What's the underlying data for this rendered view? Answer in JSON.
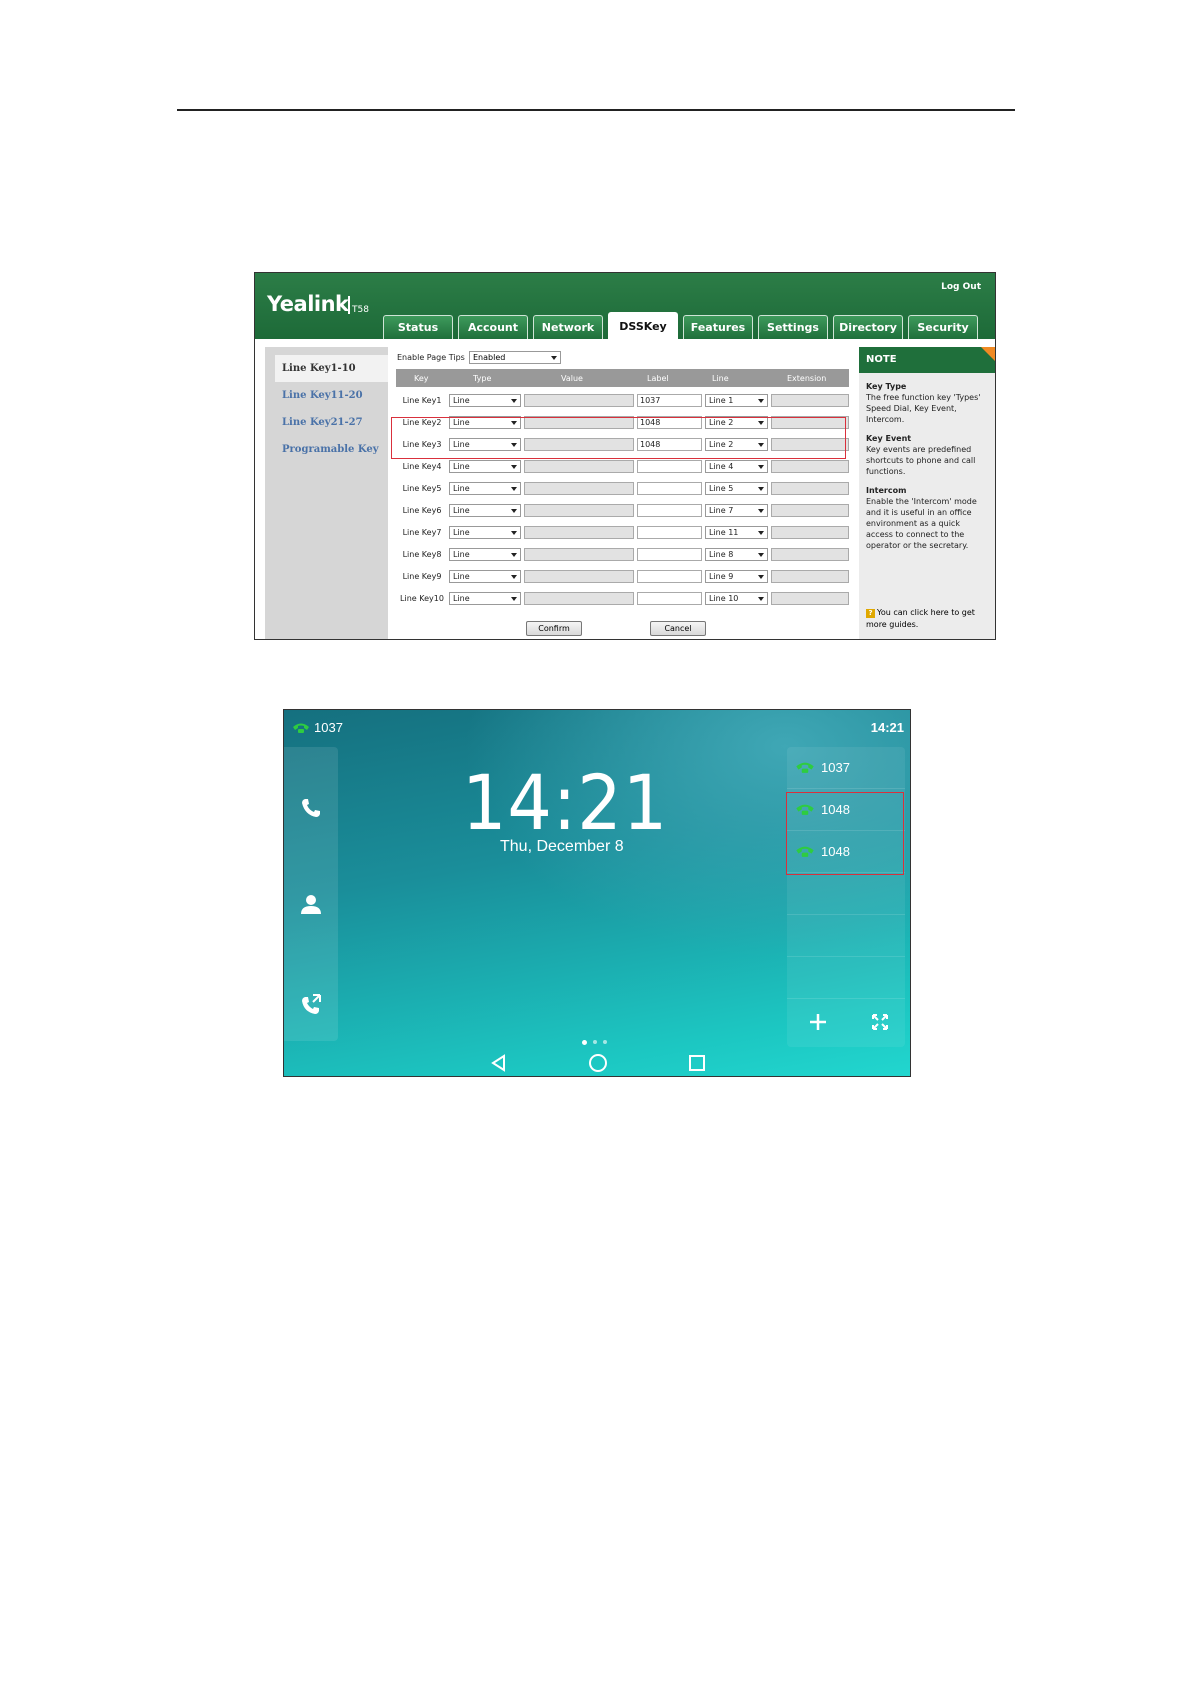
{
  "web": {
    "logo": "Yealink",
    "model": "T58",
    "logout": "Log Out",
    "tabs": [
      "Status",
      "Account",
      "Network",
      "DSSKey",
      "Features",
      "Settings",
      "Directory",
      "Security"
    ],
    "active_tab": "DSSKey",
    "nav": [
      "Line Key1-10",
      "Line Key11-20",
      "Line Key21-27",
      "Programable Key"
    ],
    "enable_page_tips_label": "Enable Page Tips",
    "enable_page_tips_value": "Enabled",
    "columns": [
      "Key",
      "Type",
      "Value",
      "Label",
      "Line",
      "Extension"
    ],
    "rows": [
      {
        "key": "Line Key1",
        "type": "Line",
        "value": "",
        "label": "1037",
        "line": "Line 1"
      },
      {
        "key": "Line Key2",
        "type": "Line",
        "value": "",
        "label": "1048",
        "line": "Line 2"
      },
      {
        "key": "Line Key3",
        "type": "Line",
        "value": "",
        "label": "1048",
        "line": "Line 2"
      },
      {
        "key": "Line Key4",
        "type": "Line",
        "value": "",
        "label": "",
        "line": "Line 4"
      },
      {
        "key": "Line Key5",
        "type": "Line",
        "value": "",
        "label": "",
        "line": "Line 5"
      },
      {
        "key": "Line Key6",
        "type": "Line",
        "value": "",
        "label": "",
        "line": "Line 7"
      },
      {
        "key": "Line Key7",
        "type": "Line",
        "value": "",
        "label": "",
        "line": "Line 11"
      },
      {
        "key": "Line Key8",
        "type": "Line",
        "value": "",
        "label": "",
        "line": "Line 8"
      },
      {
        "key": "Line Key9",
        "type": "Line",
        "value": "",
        "label": "",
        "line": "Line 9"
      },
      {
        "key": "Line Key10",
        "type": "Line",
        "value": "",
        "label": "",
        "line": "Line 10"
      }
    ],
    "confirm": "Confirm",
    "cancel": "Cancel",
    "note": {
      "title": "NOTE",
      "sections": [
        {
          "heading": "Key Type",
          "text": "The free function key 'Types' Speed Dial, Key Event, Intercom."
        },
        {
          "heading": "Key Event",
          "text": "Key events are predefined shortcuts to phone and call functions."
        },
        {
          "heading": "Intercom",
          "text": "Enable the 'Intercom' mode and it is useful in an office environment as a quick access to connect to the operator or the secretary."
        }
      ],
      "guide": "You can click here to get more guides."
    }
  },
  "phone": {
    "status_line": "1037",
    "status_time": "14:21",
    "clock": "14:21",
    "date": "Thu, December 8",
    "line_keys": [
      "1037",
      "1048",
      "1048"
    ],
    "accent": "#2ecc40"
  }
}
